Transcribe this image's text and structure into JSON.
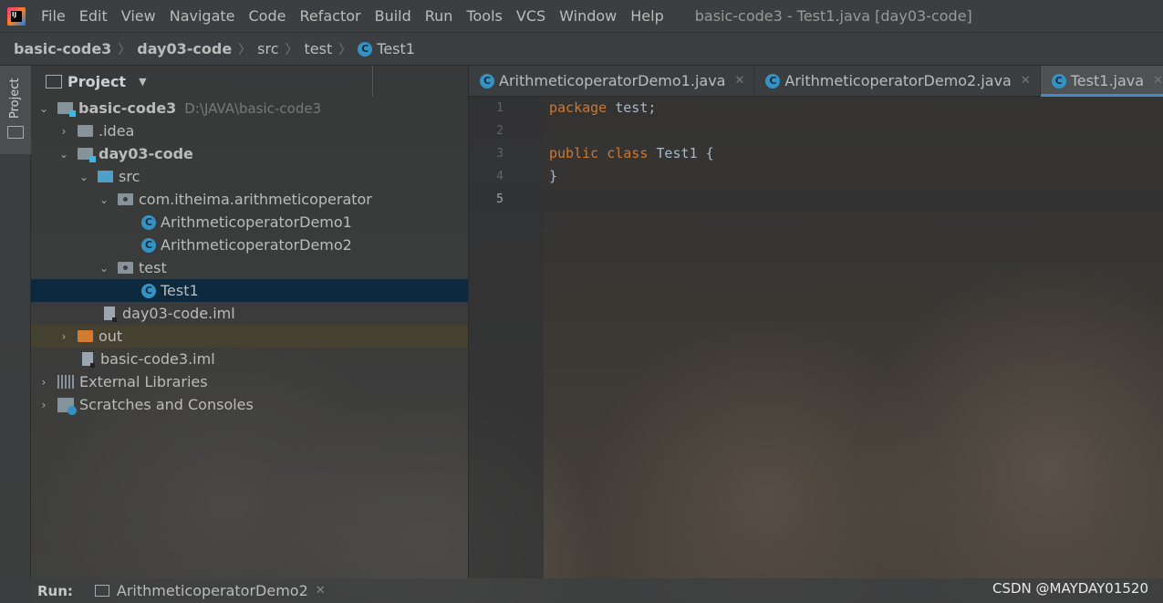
{
  "menubar": {
    "items": [
      "File",
      "Edit",
      "View",
      "Navigate",
      "Code",
      "Refactor",
      "Build",
      "Run",
      "Tools",
      "VCS",
      "Window",
      "Help"
    ],
    "window_title": "basic-code3 - Test1.java [day03-code]"
  },
  "breadcrumb": {
    "items": [
      "basic-code3",
      "day03-code",
      "src",
      "test",
      "Test1"
    ]
  },
  "sidebar_strip": {
    "label": "Project"
  },
  "project_panel": {
    "title": "Project",
    "tree": [
      {
        "label": "basic-code3",
        "hint": "D:\\JAVA\\basic-code3"
      },
      {
        "label": ".idea"
      },
      {
        "label": "day03-code"
      },
      {
        "label": "src"
      },
      {
        "label": "com.itheima.arithmeticoperator"
      },
      {
        "label": "ArithmeticoperatorDemo1"
      },
      {
        "label": "ArithmeticoperatorDemo2"
      },
      {
        "label": "test"
      },
      {
        "label": "Test1"
      },
      {
        "label": "day03-code.iml"
      },
      {
        "label": "out"
      },
      {
        "label": "basic-code3.iml"
      },
      {
        "label": "External Libraries"
      },
      {
        "label": "Scratches and Consoles"
      }
    ]
  },
  "editor": {
    "tabs": [
      {
        "label": "ArithmeticoperatorDemo1.java"
      },
      {
        "label": "ArithmeticoperatorDemo2.java"
      },
      {
        "label": "Test1.java"
      }
    ],
    "line_numbers": [
      "1",
      "2",
      "3",
      "4",
      "5"
    ],
    "code": {
      "line1_kw": "package",
      "line1_rest": " test;",
      "line3_kw1": "public",
      "line3_kw2": "class",
      "line3_name": "Test1",
      "line3_rest": " {",
      "line4": "}"
    }
  },
  "run_bar": {
    "label": "Run:",
    "tab": "ArithmeticoperatorDemo2"
  },
  "watermark": "CSDN @MAYDAY01520",
  "colors": {
    "accent": "#4a88c7",
    "keyword": "#cc7832",
    "class_icon": "#3592c4",
    "selection": "#0d293e"
  }
}
